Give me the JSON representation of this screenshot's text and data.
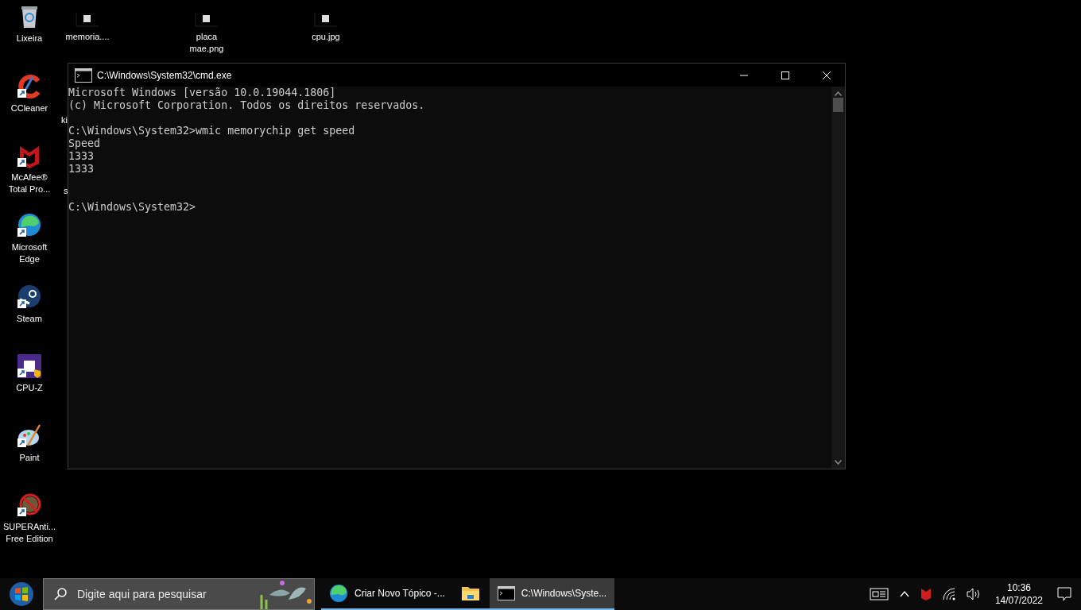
{
  "desktop": {
    "icons": [
      {
        "label": "Lixeira",
        "kind": "trash"
      },
      {
        "label": "memoria....",
        "kind": "image-file"
      },
      {
        "label": "placa\nmae.png",
        "kind": "image-file"
      },
      {
        "label": "cpu.jpg",
        "kind": "image-file"
      },
      {
        "label": "CCleaner",
        "kind": "ccleaner"
      },
      {
        "label": "McAfee®\nTotal Pro...",
        "kind": "mcafee"
      },
      {
        "label": "Microsoft\nEdge",
        "kind": "edge"
      },
      {
        "label": "Steam",
        "kind": "steam"
      },
      {
        "label": "CPU-Z",
        "kind": "cpuz"
      },
      {
        "label": "Paint",
        "kind": "paint"
      },
      {
        "label": "SUPERAnti...\nFree Edition",
        "kind": "superanti"
      }
    ],
    "hidden_labels": [
      "ki",
      "s"
    ]
  },
  "console": {
    "title": "C:\\Windows\\System32\\cmd.exe",
    "blocks": [
      {
        "kind": "banner",
        "lines": [
          "Microsoft Windows [versão 10.0.19044.1806]",
          "(c) Microsoft Corporation. Todos os direitos reservados."
        ]
      },
      {
        "kind": "command",
        "lines": [
          "C:\\Windows\\System32>wmic memorychip get speed",
          "Speed",
          "1333",
          "1333"
        ]
      },
      {
        "kind": "prompt",
        "lines": [
          "C:\\Windows\\System32>"
        ]
      }
    ]
  },
  "taskbar": {
    "search": {
      "placeholder": "Digite aqui para pesquisar"
    },
    "tasks": [
      {
        "label": "Criar Novo Tópico -...",
        "kind": "edge",
        "selected": false
      },
      {
        "kind": "explorer",
        "selected": false
      },
      {
        "label": "C:\\Windows\\Syste...",
        "kind": "cmd",
        "selected": true
      }
    ],
    "clock": {
      "time": "10:36",
      "date": "14/07/2022"
    }
  }
}
